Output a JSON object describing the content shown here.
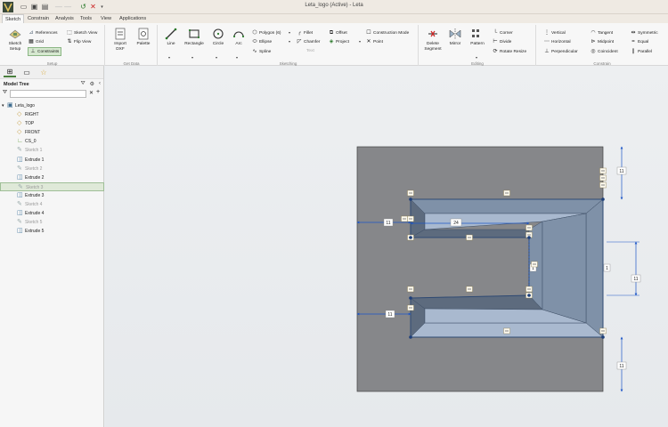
{
  "titlebar": {
    "title": "Leta_logo (Active) - Leta"
  },
  "menu": {
    "tabs": [
      "Sketch",
      "Constrain",
      "Analysis",
      "Tools",
      "View",
      "Applications"
    ],
    "active": "Sketch"
  },
  "ribbon": {
    "setup": {
      "label": "Setup",
      "sketch_setup": "Sketch\nSetup",
      "references": "References",
      "grid": "Grid",
      "constraints": "Constraints",
      "sketch_view": "Sketch View",
      "flip_view": "Flip View"
    },
    "get_data": {
      "label": "Get Data",
      "import_dxf": "Import\nDXF",
      "palette": "Palette"
    },
    "sketching": {
      "label": "Sketching",
      "line": "Line",
      "rectangle": "Rectangle",
      "circle": "Circle",
      "arc": "Arc",
      "polygon": "Polygon (6)",
      "ellipse": "Ellipse",
      "spline": "Spline",
      "fillet": "Fillet",
      "chamfer": "Chamfer",
      "text": "Text",
      "offset": "Offset",
      "project": "Project",
      "construction_mode": "Construction Mode",
      "point": "Point"
    },
    "editing": {
      "label": "Editing",
      "delete_segment": "Delete\nSegment",
      "mirror": "Mirror",
      "pattern": "Pattern",
      "corner": "Corner",
      "divide": "Divide",
      "rotate_resize": "Rotate Resize"
    },
    "constrain": {
      "label": "Constrain",
      "vertical": "Vertical",
      "horizontal": "Horizontal",
      "perpendicular": "Perpendicular",
      "tangent": "Tangent",
      "midpoint": "Midpoint",
      "coincident": "Coincident",
      "symmetric": "Symmetric",
      "equal": "Equal",
      "parallel": "Parallel"
    }
  },
  "sidepanel": {
    "title": "Model Tree",
    "tree": [
      {
        "label": "Leta_logo",
        "icon": "part-icon",
        "dim": false,
        "sel": false,
        "indent": 0
      },
      {
        "label": "RIGHT",
        "icon": "plane-icon",
        "dim": false,
        "sel": false,
        "indent": 1
      },
      {
        "label": "TOP",
        "icon": "plane-icon",
        "dim": false,
        "sel": false,
        "indent": 1
      },
      {
        "label": "FRONT",
        "icon": "plane-icon",
        "dim": false,
        "sel": false,
        "indent": 1
      },
      {
        "label": "CS_0",
        "icon": "axis-icon",
        "dim": false,
        "sel": false,
        "indent": 1
      },
      {
        "label": "Sketch 1",
        "icon": "sketch-icon",
        "dim": true,
        "sel": false,
        "indent": 1
      },
      {
        "label": "Extrude 1",
        "icon": "extrude-icon",
        "dim": false,
        "sel": false,
        "indent": 1
      },
      {
        "label": "Sketch 2",
        "icon": "sketch-icon",
        "dim": true,
        "sel": false,
        "indent": 1
      },
      {
        "label": "Extrude 2",
        "icon": "extrude-icon",
        "dim": false,
        "sel": false,
        "indent": 1
      },
      {
        "label": "Sketch 3",
        "icon": "sketch-icon",
        "dim": true,
        "sel": true,
        "indent": 1
      },
      {
        "label": "Extrude 3",
        "icon": "extrude-icon",
        "dim": false,
        "sel": false,
        "indent": 1
      },
      {
        "label": "Sketch 4",
        "icon": "sketch-icon",
        "dim": true,
        "sel": false,
        "indent": 1
      },
      {
        "label": "Extrude 4",
        "icon": "extrude-icon",
        "dim": false,
        "sel": false,
        "indent": 1
      },
      {
        "label": "Sketch 5",
        "icon": "sketch-icon",
        "dim": true,
        "sel": false,
        "indent": 1
      },
      {
        "label": "Extrude 5",
        "icon": "extrude-icon",
        "dim": false,
        "sel": false,
        "indent": 1
      }
    ]
  },
  "viewport": {
    "dimensions": {
      "top_right": "11",
      "left_top": "11",
      "inner_width": "24",
      "left_lower": "11",
      "right_mid": "11",
      "bottom_right": "11",
      "inner_height": "1",
      "right_small": "1"
    },
    "colors": {
      "plate": "#86878a",
      "face_light": "#a9b9cf",
      "face_mid": "#7f91a8",
      "face_dark": "#5d6b7e",
      "dimension": "#1d56c7",
      "constraint_badge": "#e8c46b"
    }
  }
}
